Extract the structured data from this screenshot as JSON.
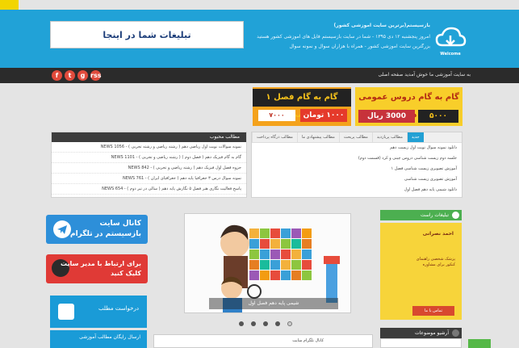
{
  "header": {
    "ad_text": "تبلیغات شما در اینجا",
    "site_title": "بازسیستم(برترین سایت آموزشی کشور)",
    "intro_line1": "امروز پنجشنبه ۱۲ دی ۱۳۹۵ - شما در سایت بازسیستم فایل های آموزشی کشور هستید",
    "intro_line2": "بزرگترین سایت آموزشی کشور - همراه با هزاران سوال و نمونه سوال",
    "logo_label": "Welcome"
  },
  "nav": {
    "breadcrumb": "به سایت آموزشی ما خوش آمدید صفحه اصلی",
    "social": [
      "f",
      "t",
      "g",
      "rss"
    ]
  },
  "banners": {
    "a_title": "گام به گام فصل ۱ شیمی",
    "a_old": "۷۰۰۰",
    "a_new": "۱۰۰۰ تومان",
    "b_title": "گام به گام دروس عمومی دهم",
    "b_old": "3000 ریال",
    "b_new": "۵۰۰۰"
  },
  "popular": {
    "title": "مطالب محبوب",
    "items": [
      "نمونه سوالات نوبت اول ریاضی دهم ( رشته ریاضی و رشته تجربی ) - 1056 NEWS",
      "گام به گام فیزیک دهم ( فصل دوم ) ( رشته ریاضی و تجربی ) - 1101 NEWS",
      "جزوه فصل اول فیزیک دهم ( رشته ریاضی و تجربی ) - 842 NEWS",
      "نمونه سوال درس ۳ جغرافیا پایه دهم ( جغرافیای ایران ) - 761 NEWS",
      "پاسخ فعالیت نگاری هنر فصل ۵ نگارش پایه دهم ( سالی در تیر دوم ) - 654 NEWS"
    ]
  },
  "news": {
    "tabs": [
      "جدید",
      "مطالب پربازدید",
      "مطالب پربحث",
      "مطالب پیشنهادی ما",
      "مطالب درگاه پرداخت"
    ],
    "items": [
      "دانلود نمونه سوال نوبت اول زیست دهم",
      "جلسه دوم زیست شناسی دروس چینی و کرد (قسمت دوم)",
      "آموزش تصویری زیست شناسی فصل ۱",
      "آموزش تصویری زیست شناسی",
      "دانلود شیمی پایه دهم فصل اول"
    ]
  },
  "left": {
    "telegram_l1": "کانال سایت",
    "telegram_l2": "بازسیستم در تلگرام",
    "contact_l1": "برای ارتباط با مدیر سایت",
    "contact_l2": "کلیک کنید",
    "request": "درخواست مطلب",
    "request2": "ارسال رایگان مطالب آموزشی"
  },
  "slider": {
    "caption": "شیمی پایه دهم فصل اول",
    "dots": 5,
    "active_dot": 4,
    "bottom_label": "کانال تلگرام سایت"
  },
  "right": {
    "ads_title": "تبلیغات راست",
    "ad_name": "احمد نصرانی",
    "ad_desc": "پزشک شخصی راهنمای کنکور برای مشاوره",
    "ad_button": "تماس با ما",
    "archive_title": "آرشیو موضوعات"
  },
  "colors": {
    "header_blue": "#21a2d7",
    "dark_bar": "#2b2b2b",
    "accent_green": "#4caf50",
    "social_red": "#e04b3c"
  }
}
